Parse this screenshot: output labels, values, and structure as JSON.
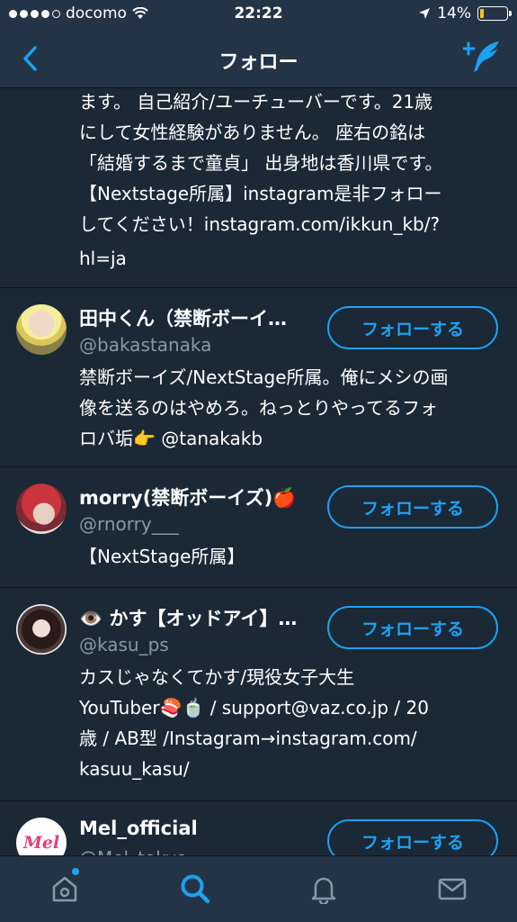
{
  "status": {
    "carrier": "docomo",
    "time": "22:22",
    "battery": "14%",
    "battery_level": 0.14
  },
  "nav": {
    "title": "フォロー"
  },
  "top_bio": {
    "lines": [
      "ます。 自己紹介/ユーチューバーです。21歳",
      "にして女性経験がありません。 座右の銘は",
      "「結婚するまで童貞」 出身地は香川県です。",
      "【Nextstage所属】instagram是非フォロー",
      "してください！instagram.com/ikkun_kb/?",
      "hl=ja"
    ]
  },
  "users": [
    {
      "name": "田中くん（禁断ボーイ…",
      "handle": "@bakastanaka",
      "bio_lines": [
        "禁断ボーイズ/NextStage所属。俺にメシの画",
        "像を送るのはやめろ。ねっとりやってるフォ",
        "ロバ垢👉 @tanakakb"
      ],
      "follow_label": "フォローする"
    },
    {
      "name": "morry(禁断ボーイズ)🍎",
      "handle": "@rnorry___",
      "bio_lines": [
        "【NextStage所属】"
      ],
      "follow_label": "フォローする"
    },
    {
      "name": "👁️ かす【オッドアイ】…",
      "handle": "@kasu_ps",
      "bio_lines": [
        "カスじゃなくてかす/現役女子大生",
        "YouTuber🍣🍵 / support@vaz.co.jp / 20",
        "歳 / AB型 /Instagram→instagram.com/",
        "kasuu_kasu/"
      ],
      "follow_label": "フォローする"
    },
    {
      "name": "Mel_official",
      "handle": "@Mel_tokyo",
      "bio_lines": [],
      "follow_label": "フォローする",
      "avatar_text": "Mel"
    }
  ],
  "colors": {
    "accent": "#1da1f2",
    "background": "#1b2836",
    "bar": "#243447",
    "secondary_text": "#8899a6"
  },
  "tabs": [
    "home-icon",
    "search-icon",
    "bell-icon",
    "mail-icon"
  ]
}
